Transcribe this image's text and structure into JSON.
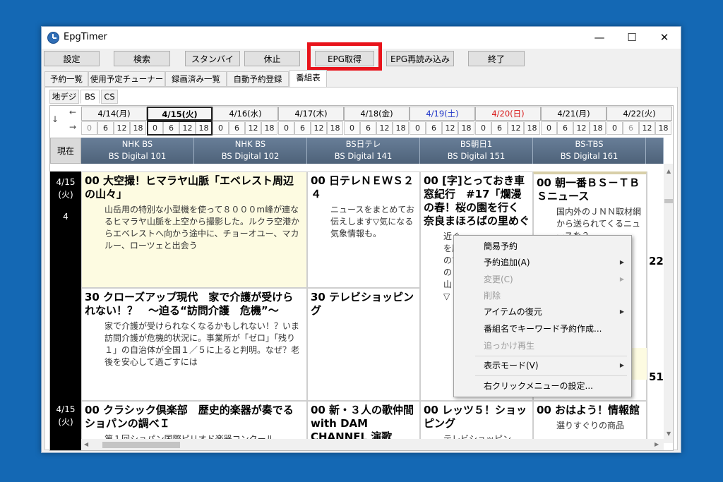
{
  "window": {
    "title": "EpgTimer",
    "controls": [
      "—",
      "☐",
      "✕"
    ]
  },
  "toolbar": {
    "settings": "設定",
    "search": "検索",
    "standby": "スタンバイ",
    "pause": "休止",
    "epg_get": "EPG取得",
    "epg_reload": "EPG再読み込み",
    "exit": "終了"
  },
  "tabs": [
    "予約一覧",
    "使用予定チューナー",
    "録画済み一覧",
    "自動予約登録",
    "番組表"
  ],
  "subtabs": [
    "地デジ",
    "BS",
    "CS"
  ],
  "nav": {
    "left": "←",
    "right": "→",
    "down": "↓"
  },
  "dates": [
    "4/14(月)",
    "4/15(火)",
    "4/16(水)",
    "4/17(木)",
    "4/18(金)",
    "4/19(土)",
    "4/20(日)",
    "4/21(月)",
    "4/22(火)"
  ],
  "hours": [
    "0",
    "6",
    "12",
    "18"
  ],
  "now_button": "現在",
  "services": [
    {
      "name": "NHK BS",
      "sub": "BS Digital 101"
    },
    {
      "name": "NHK BS",
      "sub": "BS Digital 102"
    },
    {
      "name": "BS日テレ",
      "sub": "BS Digital 141"
    },
    {
      "name": "BS朝日1",
      "sub": "BS Digital 151"
    },
    {
      "name": "BS-TBS",
      "sub": "BS Digital 161"
    }
  ],
  "timecol": {
    "date1": "4/15",
    "day1": "(火)",
    "hour1": "4",
    "date2": "4/15",
    "day2": "(火)"
  },
  "programs": {
    "p1": {
      "min": "00",
      "title": "大空撮！ヒマラヤ山脈「エベレスト周辺の山々」",
      "desc": "山岳用の特別な小型機を使って８０００m峰が連なるヒマラヤ山脈を上空から撮影した。ルクラ空港からエベレストへ向かう途中に、チョーオユー、マカルー、ローツェと出会う"
    },
    "p2": {
      "min": "30",
      "title": "クローズアップ現代　家で介護が受けられない！？　～迫る“訪問介護　危機”～",
      "desc": "家で介護が受けられなくなるかもしれない！？いま訪問介護が危機的状況に。事業所が「ゼロ」「残り１」の自治体が全国１／５に上ると判明。なぜ？老後を安心して過ごすには"
    },
    "p3": {
      "min": "00",
      "title": "クラシック倶楽部　歴史的楽器が奏でるショパンの調べＩ",
      "desc": "第１回ショパン国際ピリオド楽器コンクール"
    },
    "p4": {
      "min": "00",
      "title": "日テレＮＥＷＳ２４",
      "desc": "ニュースをまとめてお伝えします▽気になる気象情報も。"
    },
    "p5": {
      "min": "30",
      "title": "テレビショッピング",
      "desc": ""
    },
    "p6": {
      "min": "00",
      "title": "新・３人の歌仲間 with DAM CHANNEL 演歌",
      "desc": ""
    },
    "p7": {
      "min": "00",
      "title": "[字]とっておき車窓紀行　#17「爛漫の春！桜の園を行く 奈良まほろばの里めぐ",
      "desc": "近ぐを歴の古の山・▽"
    },
    "p8": {
      "min": "00",
      "title": "レッツ５！ショッピング",
      "desc": "テレビショッピン"
    },
    "p9": {
      "min": "00",
      "title": "朝一番ＢＳ－ＴＢＳニュース",
      "desc": "国内外のＪＮＮ取材網から送られてくるニュースを２"
    },
    "p10": {
      "min": "00",
      "title": "おはよう！情報館",
      "desc": "選りすぐりの商品"
    },
    "side1": "22",
    "side2": "51"
  },
  "context_menu": {
    "items": [
      "簡易予約",
      "予約追加(A)",
      "変更(C)",
      "削除",
      "アイテムの復元",
      "番組名でキーワード予約作成...",
      "追っかけ再生",
      "表示モード(V)",
      "右クリックメニューの設定..."
    ]
  },
  "colors": {
    "highlight": "#e8131b",
    "saturday": "#1f35c8",
    "sunday": "#d81818",
    "service_header": "#5a6e86"
  }
}
